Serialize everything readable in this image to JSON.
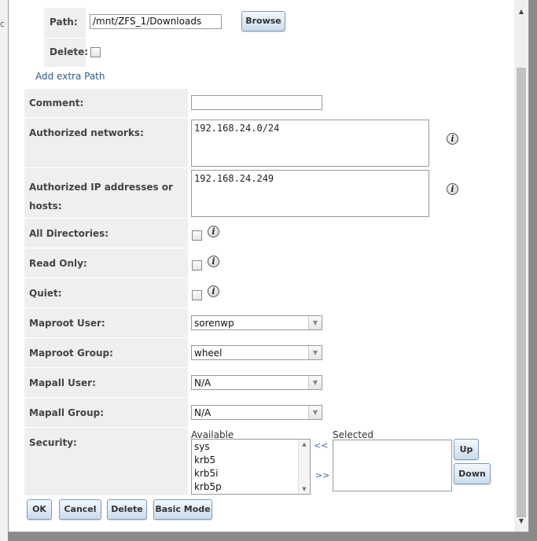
{
  "background": {
    "partial_text": "c"
  },
  "form": {
    "path": {
      "label": "Path:",
      "value": "/mnt/ZFS_1/Downloads",
      "browse_label": "Browse"
    },
    "delete_row": {
      "label": "Delete:"
    },
    "add_extra_path_label": "Add extra Path",
    "comment": {
      "label": "Comment:",
      "value": ""
    },
    "authorized_networks": {
      "label": "Authorized networks:",
      "value": "192.168.24.0/24"
    },
    "authorized_hosts": {
      "label_line1": "Authorized IP addresses or",
      "label_line2": "hosts:",
      "value": "192.168.24.249"
    },
    "all_directories": {
      "label": "All Directories:"
    },
    "read_only": {
      "label": "Read Only:"
    },
    "quiet": {
      "label": "Quiet:"
    },
    "maproot_user": {
      "label": "Maproot User:",
      "value": "sorenwp"
    },
    "maproot_group": {
      "label": "Maproot Group:",
      "value": "wheel"
    },
    "mapall_user": {
      "label": "Mapall User:",
      "value": "N/A"
    },
    "mapall_group": {
      "label": "Mapall Group:",
      "value": "N/A"
    },
    "security": {
      "label": "Security:",
      "available_label": "Available",
      "selected_label": "Selected",
      "available_items": [
        "sys",
        "krb5",
        "krb5i",
        "krb5p"
      ],
      "move_left": "<<",
      "move_right": ">>",
      "up_label": "Up",
      "down_label": "Down"
    }
  },
  "actions": {
    "ok": "OK",
    "cancel": "Cancel",
    "delete": "Delete",
    "basic_mode": "Basic Mode"
  },
  "icons": {
    "info": "info-icon",
    "checkbox": "checkbox",
    "dropdown": "chevron-down-icon"
  },
  "colors": {
    "label_bg": "#efefef",
    "button_gradient_top": "#f4f8fc",
    "button_gradient_bottom": "#c9dced",
    "link": "#2d5e8c"
  }
}
